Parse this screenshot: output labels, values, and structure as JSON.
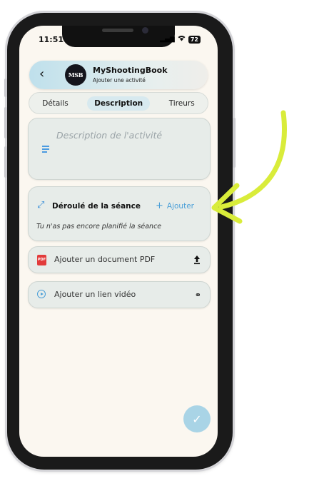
{
  "status_bar": {
    "time": "11:51",
    "signal": "▂▄▆",
    "battery": "72"
  },
  "header": {
    "logo_text": "MSB",
    "title": "MyShootingBook",
    "subtitle": "Ajouter une activité"
  },
  "tabs": [
    {
      "label": "Détails",
      "active": false
    },
    {
      "label": "Description",
      "active": true
    },
    {
      "label": "Tireurs",
      "active": false
    }
  ],
  "description": {
    "placeholder": "Description de l'activité"
  },
  "session": {
    "title": "Déroulé de la séance",
    "add_label": "Ajouter",
    "empty_text": "Tu n'as pas encore planifié la séance"
  },
  "pdf": {
    "icon_text": "PDF",
    "label": "Ajouter un document PDF"
  },
  "video": {
    "label": "Ajouter un lien vidéo"
  },
  "fab": {
    "glyph": "✓"
  },
  "colors": {
    "accent": "#4a9fd8",
    "arrow": "#d9ec3a",
    "background": "#fbf7f0"
  }
}
